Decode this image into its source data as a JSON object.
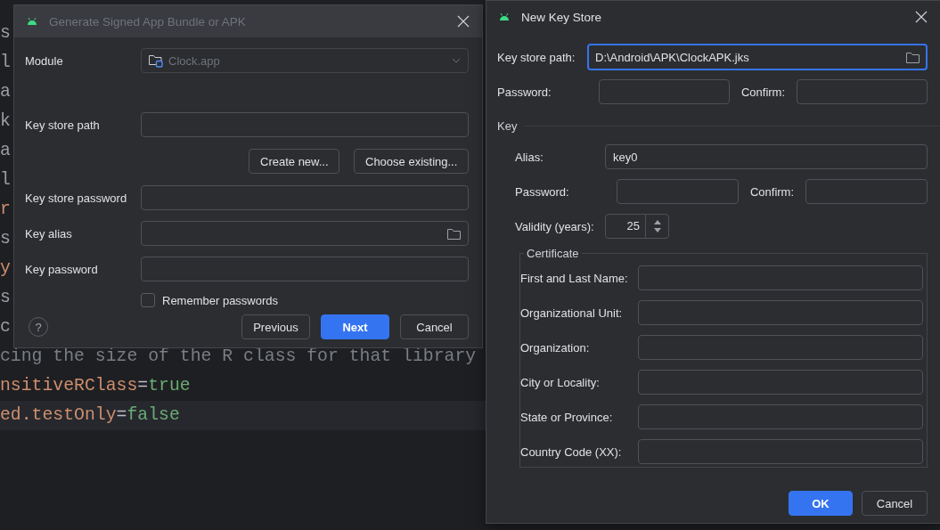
{
  "editor": {
    "lines": [
      {
        "segments": [
          {
            "kind": "text",
            "text": "s"
          }
        ],
        "current": false
      },
      {
        "segments": [
          {
            "kind": "text",
            "text": "l"
          }
        ],
        "current": false
      },
      {
        "segments": [
          {
            "kind": "text",
            "text": "a"
          }
        ],
        "current": false
      },
      {
        "segments": [
          {
            "kind": "text",
            "text": "k"
          }
        ],
        "current": false
      },
      {
        "segments": [
          {
            "kind": "text",
            "text": "a"
          }
        ],
        "current": false
      },
      {
        "segments": [
          {
            "kind": "text",
            "text": "l"
          }
        ],
        "current": false
      },
      {
        "segments": [
          {
            "kind": "key",
            "text": "r"
          }
        ],
        "current": false
      },
      {
        "segments": [
          {
            "kind": "text",
            "text": "s"
          }
        ],
        "current": false
      },
      {
        "segments": [
          {
            "kind": "key",
            "text": "y"
          }
        ],
        "current": false
      },
      {
        "segments": [
          {
            "kind": "text",
            "text": "s"
          }
        ],
        "current": false
      },
      {
        "segments": [
          {
            "kind": "text",
            "text": "c"
          }
        ],
        "current": false
      },
      {
        "segments": [
          {
            "kind": "comment",
            "text": "cing the size of the R class for that library"
          }
        ],
        "current": false
      },
      {
        "segments": [
          {
            "kind": "key",
            "text": "nsitiveRClass"
          },
          {
            "kind": "op",
            "text": "="
          },
          {
            "kind": "value",
            "text": "true"
          }
        ],
        "current": false
      },
      {
        "segments": [
          {
            "kind": "key",
            "text": "ed.testOnly"
          },
          {
            "kind": "op",
            "text": "="
          },
          {
            "kind": "value",
            "text": "false"
          }
        ],
        "current": true
      }
    ]
  },
  "signed_dialog": {
    "title": "Generate Signed App Bundle or APK",
    "active": false,
    "module": {
      "label": "Module",
      "value": "Clock.app",
      "disabled": true
    },
    "key_store_path": {
      "label": "Key store path"
    },
    "store_buttons": [
      "Create new...",
      "Choose existing..."
    ],
    "fields": [
      {
        "label": "Key store password",
        "kind": "text"
      },
      {
        "label": "Key alias",
        "kind": "browse"
      },
      {
        "label": "Key password",
        "kind": "text"
      }
    ],
    "remember": {
      "label": "Remember passwords",
      "checked": false
    },
    "help": "?",
    "buttons": [
      {
        "label": "Previous",
        "primary": false
      },
      {
        "label": "Next",
        "primary": true
      },
      {
        "label": "Cancel",
        "primary": false
      }
    ]
  },
  "key_store_dialog": {
    "title": "New Key Store",
    "active": true,
    "path": {
      "label": "Key store path:",
      "value": "D:\\Android\\APK\\ClockAPK.jks",
      "focused": true
    },
    "password": {
      "label": "Password:"
    },
    "confirm": {
      "label": "Confirm:"
    },
    "key": {
      "title": "Key",
      "alias": {
        "label": "Alias:",
        "value": "key0"
      },
      "password": {
        "label": "Password:"
      },
      "confirm": {
        "label": "Confirm:"
      },
      "validity": {
        "label": "Validity (years):",
        "value": "25"
      },
      "certificate": {
        "title": "Certificate",
        "fields": [
          {
            "label": "First and Last Name:"
          },
          {
            "label": "Organizational Unit:"
          },
          {
            "label": "Organization:"
          },
          {
            "label": "City or Locality:"
          },
          {
            "label": "State or Province:"
          },
          {
            "label": "Country Code (XX):"
          }
        ]
      }
    },
    "buttons": [
      {
        "label": "OK",
        "primary": true
      },
      {
        "label": "Cancel",
        "primary": false
      }
    ]
  }
}
